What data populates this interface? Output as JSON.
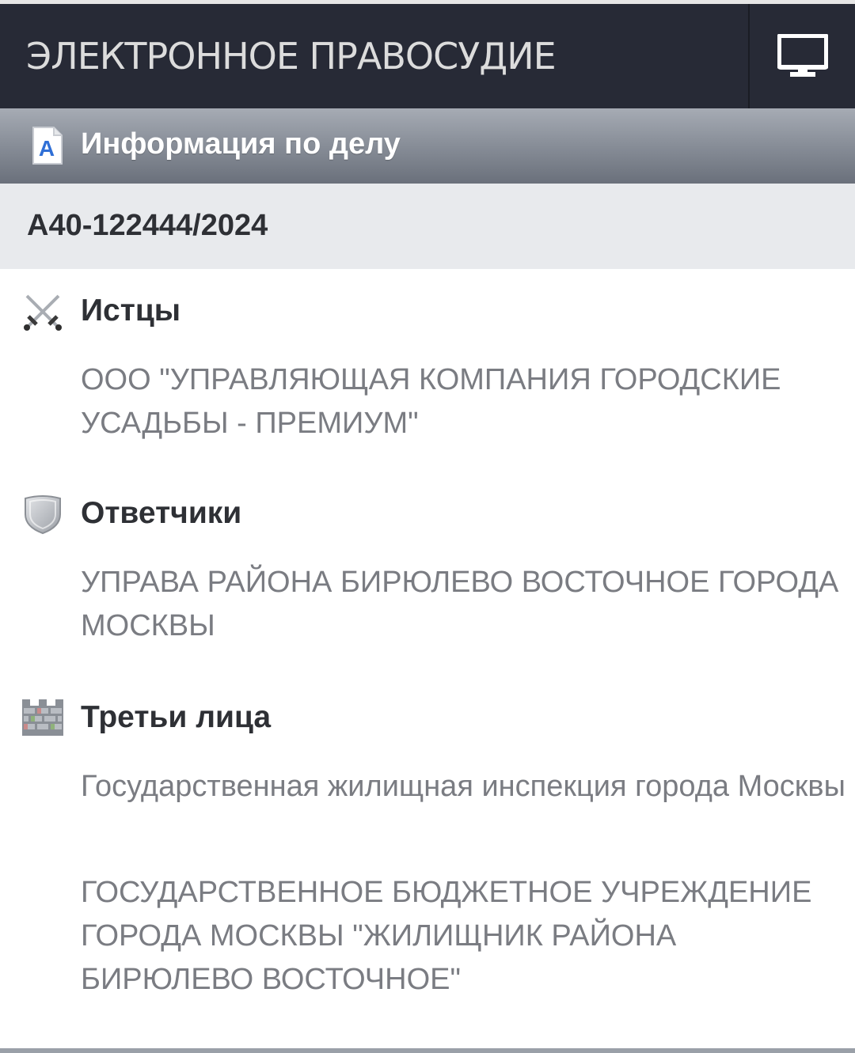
{
  "header": {
    "app_title": "ЭЛЕКТРОННОЕ ПРАВОСУДИЕ",
    "desktop_icon": "desktop-monitor-icon"
  },
  "section": {
    "icon": "document-a-icon",
    "title": "Информация по делу"
  },
  "case": {
    "number": "А40-122444/2024"
  },
  "parties": {
    "plaintiffs": {
      "icon": "crossed-swords-icon",
      "title": "Истцы",
      "items": [
        "ООО \"УПРАВЛЯЮЩАЯ КОМПАНИЯ ГОРОДСКИЕ УСАДЬБЫ - ПРЕМИУМ\""
      ]
    },
    "defendants": {
      "icon": "shield-icon",
      "title": "Ответчики",
      "items": [
        "УПРАВА РАЙОНА БИРЮЛЕВО ВОСТОЧНОЕ ГОРОДА МОСКВЫ"
      ]
    },
    "third_parties": {
      "icon": "brick-wall-icon",
      "title": "Третьи лица",
      "items": [
        "Государственная жилищная инспекция города Москвы",
        "ГОСУДАРСТВЕННОЕ БЮДЖЕТНОЕ УЧРЕЖДЕНИЕ ГОРОДА МОСКВЫ \"ЖИЛИЩНИК РАЙОНА БИРЮЛЕВО ВОСТОЧНОЕ\""
      ]
    }
  },
  "colors": {
    "top_bar": "#272a36",
    "section_header": "#8a909a",
    "case_bar": "#e8eaed",
    "party_text": "#7a7c82",
    "heading_text": "#2e3035"
  }
}
